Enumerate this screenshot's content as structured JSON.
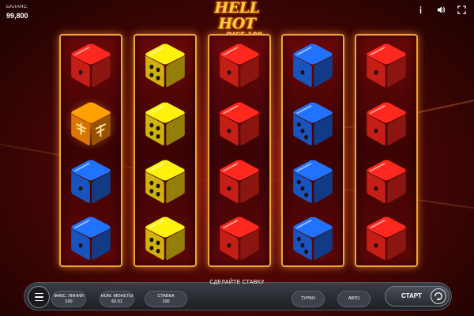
{
  "header": {
    "balance_label": "БАЛАНС",
    "balance_value": "99,800",
    "logo_main": "HELL HOT",
    "logo_sub": "DICE 100",
    "icons": [
      "info-icon",
      "sound-icon",
      "fullscreen-icon"
    ]
  },
  "reels": {
    "colors": {
      "red": "#e8231a",
      "yellow": "#f5d20c",
      "blue": "#1d63e0",
      "special": "#ff8a00"
    },
    "columns": [
      [
        {
          "color": "red",
          "pips": 1
        },
        {
          "color": "special",
          "pips": 0
        },
        {
          "color": "blue",
          "pips": 1
        },
        {
          "color": "blue",
          "pips": 1
        }
      ],
      [
        {
          "color": "yellow",
          "pips": 4
        },
        {
          "color": "yellow",
          "pips": 4
        },
        {
          "color": "yellow",
          "pips": 4
        },
        {
          "color": "yellow",
          "pips": 4
        }
      ],
      [
        {
          "color": "red",
          "pips": 1
        },
        {
          "color": "red",
          "pips": 1
        },
        {
          "color": "red",
          "pips": 1
        },
        {
          "color": "red",
          "pips": 1
        }
      ],
      [
        {
          "color": "blue",
          "pips": 1
        },
        {
          "color": "blue",
          "pips": 3
        },
        {
          "color": "blue",
          "pips": 3
        },
        {
          "color": "blue",
          "pips": 3
        }
      ],
      [
        {
          "color": "red",
          "pips": 1
        },
        {
          "color": "red",
          "pips": 1
        },
        {
          "color": "red",
          "pips": 1
        },
        {
          "color": "red",
          "pips": 1
        }
      ]
    ]
  },
  "controls": {
    "prompt": "СДЕЛАЙТЕ СТАВКУ",
    "lines_label": "ФИКС. ЛИНИИ",
    "lines_value": "100",
    "coin_label": "НОМ. МОНЕТЫ",
    "coin_value": "€0.01",
    "bet_label": "СТАВКА",
    "bet_value": "100",
    "turbo_label": "ТУРБО",
    "auto_label": "АВТО",
    "start_label": "СТАРТ"
  }
}
